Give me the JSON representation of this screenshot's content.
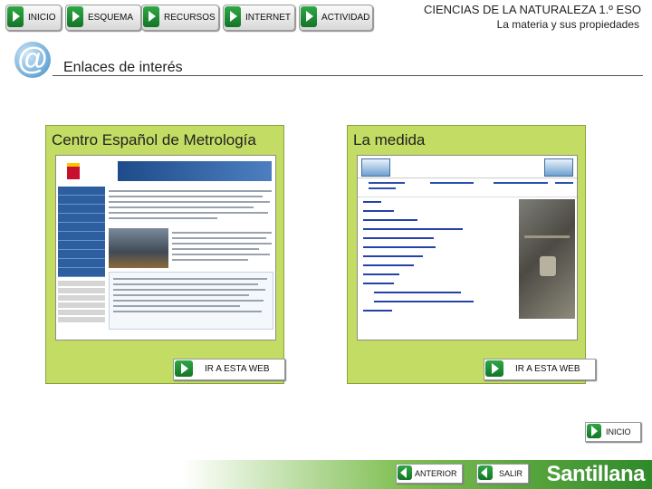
{
  "nav": {
    "items": [
      {
        "label": "INICIO",
        "icon": "play-icon"
      },
      {
        "label": "ESQUEMA",
        "icon": "play-icon"
      },
      {
        "label": "RECURSOS",
        "icon": "play-icon"
      },
      {
        "label": "INTERNET",
        "icon": "play-icon"
      },
      {
        "label": "ACTIVIDAD",
        "icon": "play-icon"
      }
    ]
  },
  "header": {
    "title": "CIENCIAS DE LA NATURALEZA 1.º ESO",
    "subtitle": "La materia y sus propiedades"
  },
  "section": {
    "title": "Enlaces de interés",
    "icon": "at-sign-icon"
  },
  "panels": [
    {
      "title": "Centro Español de Metrología",
      "button": "IR A ESTA WEB"
    },
    {
      "title": "La medida",
      "button": "IR A ESTA WEB"
    }
  ],
  "footer": {
    "inicio": "INICIO",
    "anterior": "ANTERIOR",
    "salir": "SALIR",
    "brand": "Santillana"
  },
  "colors": {
    "panel_green": "#c3dc63",
    "button_green": "#1f8c33",
    "brand_green": "#2f8a2a"
  }
}
